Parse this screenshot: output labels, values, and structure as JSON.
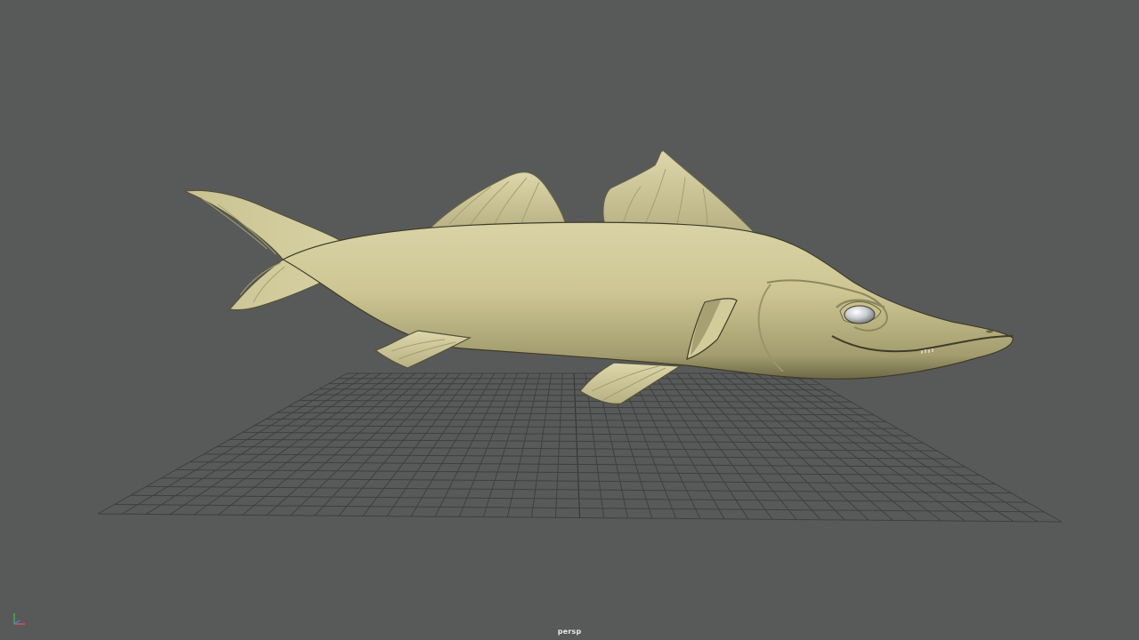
{
  "viewport": {
    "camera_name": "persp",
    "background_color": "#585a59",
    "grid_color": "#3e403f",
    "model_color": "#cfc898",
    "gizmo_icon": "axis-gizmo-icon"
  }
}
